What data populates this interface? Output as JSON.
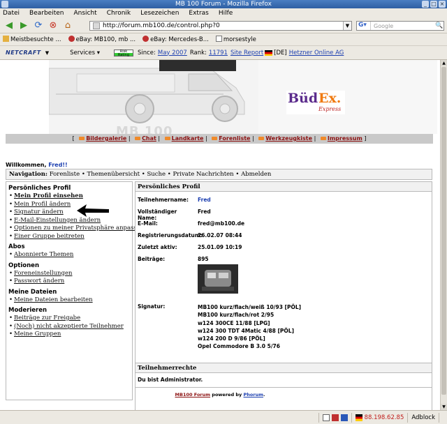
{
  "window": {
    "title": "MB 100 Forum - Mozilla Firefox"
  },
  "menu": [
    "Datei",
    "Bearbeiten",
    "Ansicht",
    "Chronik",
    "Lesezeichen",
    "Extras",
    "Hilfe"
  ],
  "navigation": {
    "url": "http://forum.mb100.de/control.php?0",
    "search_placeholder": "Google"
  },
  "bookmarks": [
    "Meistbesuchte ...",
    "eBay: MB100, mb ...",
    "eBay: Mercedes-B...",
    "morsestyle"
  ],
  "netcraft": {
    "logo": "NETCRAFT",
    "services": "Services",
    "risk": "Risk Rating",
    "since_label": "Since:",
    "since_value": "May 2007",
    "rank_label": "Rank:",
    "rank_value": "11791",
    "site_report": "Site Report",
    "country": "[DE]",
    "host": "Hetzner Online AG"
  },
  "banner": {
    "site_logo": "MB 100",
    "sponsor_left": "Büd",
    "sponsor_right": "Ex.",
    "sponsor_sub": "Express"
  },
  "top_links": [
    "Bildergalerie",
    "Chat",
    "Landkarte",
    "Forenliste",
    "Werkzeugkiste",
    "Impressum"
  ],
  "welcome": {
    "prefix": "Willkommen,",
    "user": "Fred!!"
  },
  "navbar": {
    "label": "Navigation:",
    "items": [
      "Forenliste",
      "Themenübersicht",
      "Suche",
      "Private Nachrichten",
      "Abmelden"
    ]
  },
  "sidebar": {
    "sections": [
      {
        "title": "Persönliches Profil",
        "items": [
          "Mein Profil einsehen",
          "Mein Profil ändern",
          "Signatur ändern",
          "E-Mail-Einstellungen ändern",
          "Optionen zu meiner Privatsphäre anpassen",
          "Einer Gruppe beitreten"
        ]
      },
      {
        "title": "Abos",
        "items": [
          "Abonnierte Themen"
        ]
      },
      {
        "title": "Optionen",
        "items": [
          "Foreneinstellungen",
          "Passwort ändern"
        ]
      },
      {
        "title": "Meine Dateien",
        "items": [
          "Meine Dateien bearbeiten"
        ]
      },
      {
        "title": "Moderieren",
        "items": [
          "Beiträge zur Freigabe",
          "(Noch) nicht akzeptierte Teilnehmer",
          "Meine Gruppen"
        ]
      }
    ]
  },
  "profile": {
    "heading": "Persönliches Profil",
    "rows": [
      {
        "label": "Teilnehmername:",
        "value": "Fred"
      },
      {
        "label": "Vollständiger Name:",
        "value": "Fred"
      },
      {
        "label": "E-Mail:",
        "value": "fred@mb100.de"
      },
      {
        "label": "Registrierungsdatum:",
        "value": "26.02.07 08:44"
      },
      {
        "label": "Zuletzt aktiv:",
        "value": "25.01.09 10:19"
      },
      {
        "label": "Beiträge:",
        "value": "895"
      }
    ],
    "signature_label": "Signatur:",
    "signature_lines": [
      "MB100 kurz/flach/weiß 10/93 [PÖL]",
      "MB100 kurz/flach/rot 2/95",
      "w124 300CE 11/88 [LPG]",
      "w124 300 TDT 4Matic 4/88 [PÖL]",
      "w124 200 D 9/86 [PÖL]",
      "Opel Commodore B 3.0 5/76"
    ]
  },
  "rights": {
    "heading": "Teilnehmerrechte",
    "text": "Du bist Administrator."
  },
  "footer": {
    "app": "MB100 Forum",
    "mid": "powered by",
    "engine": "Phorum",
    "end": "."
  },
  "statusbar": {
    "ip": "88.198.62.85",
    "adblock": "Adblock"
  },
  "colors": {
    "link_red": "#8b1010",
    "link_blue": "#1c3fb0",
    "accent_orange": "#f07a10",
    "sponsor_purple": "#5b2b8c"
  }
}
